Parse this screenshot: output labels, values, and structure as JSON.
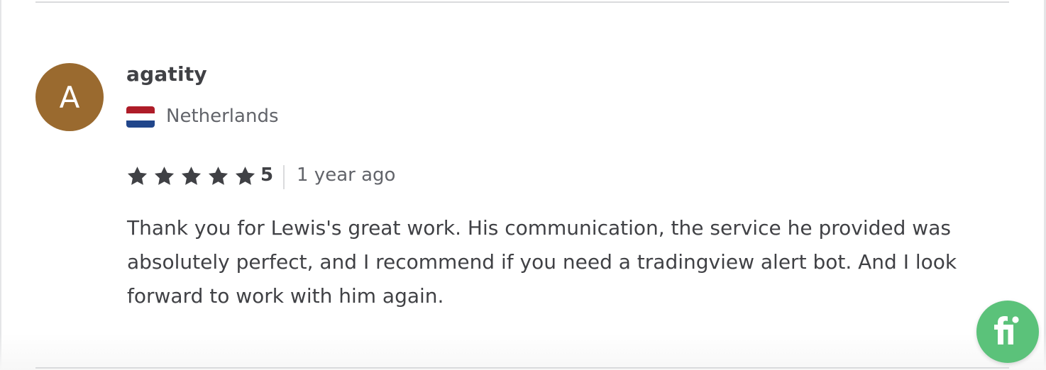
{
  "review": {
    "avatar_initial": "A",
    "username": "agatity",
    "country": "Netherlands",
    "flag_icon": "netherlands-flag-icon",
    "rating": 5,
    "rating_label": "5",
    "time_ago": "1 year ago",
    "text": "Thank you for Lewis's great work. His communication, the service he provided was absolutely perfect, and I recommend if you need a tradingview alert bot. And I look forward to work with him again."
  },
  "colors": {
    "avatar_bg": "#9a6a2f",
    "star": "#404145",
    "fab_bg": "#5bc27a"
  },
  "icons": {
    "star": "star-icon",
    "fab": "fiverr-logo-icon"
  }
}
